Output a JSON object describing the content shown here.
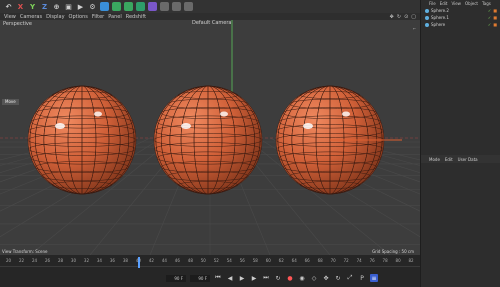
{
  "toolbar": {
    "axis_x": "X",
    "axis_y": "Y",
    "axis_z": "Z",
    "icons": [
      "undo-icon",
      "redo-icon",
      "axis-x-icon",
      "axis-y-icon",
      "axis-z-icon",
      "coordinate-icon",
      "render-region-icon",
      "render-view-icon",
      "render-settings-icon",
      "cube-icon",
      "pen-icon",
      "subdivision-icon",
      "array-icon",
      "deformer-icon",
      "field-icon",
      "scene-icon",
      "light-icon"
    ]
  },
  "menubar": {
    "items": [
      "View",
      "Cameras",
      "Display",
      "Options",
      "Filter",
      "Panel",
      "Redshift"
    ]
  },
  "viewport": {
    "name": "Perspective",
    "camera": "Default Camera",
    "hud_label": "Move",
    "footer_left": "View Transform: Scene",
    "footer_right": "Grid Spacing : 50 cm",
    "grid_color": "#4a4a4a",
    "sphere_color": "#d06038"
  },
  "timeline": {
    "ticks": [
      "20",
      "22",
      "24",
      "26",
      "28",
      "30",
      "32",
      "34",
      "36",
      "38",
      "40",
      "42",
      "44",
      "46",
      "48",
      "50",
      "52",
      "54",
      "56",
      "58",
      "60",
      "62",
      "64",
      "66",
      "68",
      "70",
      "72",
      "74",
      "76",
      "78",
      "80",
      "82"
    ],
    "current_frame": "44",
    "start_field": "90 F",
    "end_field": "90 F",
    "frame_field": "16 F"
  },
  "object_manager": {
    "menu": [
      "File",
      "Edit",
      "View",
      "Object",
      "Tags"
    ],
    "objects": [
      "Sphere.2",
      "Sphere.1",
      "Sphere"
    ]
  },
  "attribute_manager": {
    "tabs": [
      "Mode",
      "Edit",
      "User Data"
    ]
  }
}
